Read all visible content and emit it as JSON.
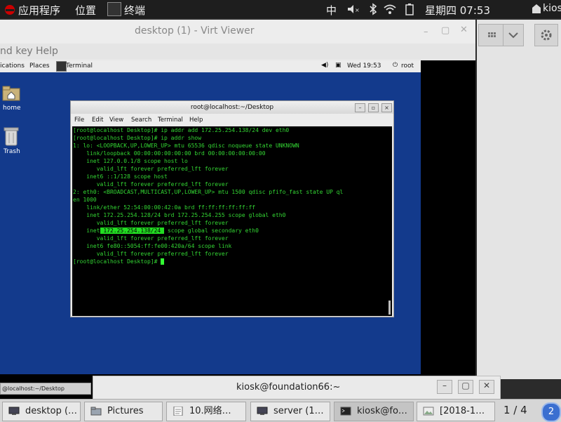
{
  "host_topbar": {
    "apps_label": "应用程序",
    "places_label": "位置",
    "terminal_label": "终端",
    "input_method": "中",
    "datetime": "星期四 07:53",
    "user": "kiosk"
  },
  "viewer": {
    "title": "desktop (1) - Virt Viewer",
    "menu_items": [
      "nd key",
      "Help"
    ]
  },
  "guest_topbar": {
    "applications": "ications",
    "places": "Places",
    "terminal": "Terminal",
    "datetime": "Wed 19:53",
    "user": "root"
  },
  "guest_desktop": {
    "icons": [
      {
        "label": "home",
        "icon": "home-folder-icon"
      },
      {
        "label": "Trash",
        "icon": "trash-icon"
      }
    ],
    "taskbar_item": "@localhost:~/Desktop",
    "workspace": "1 / 4"
  },
  "terminal": {
    "title": "root@localhost:~/Desktop",
    "menu": [
      "File",
      "Edit",
      "View",
      "Search",
      "Terminal",
      "Help"
    ],
    "lines": [
      "[root@localhost Desktop]# ip addr add 172.25.254.138/24 dev eth0",
      "[root@localhost Desktop]# ip addr show",
      "1: lo: <LOOPBACK,UP,LOWER_UP> mtu 65536 qdisc noqueue state UNKNOWN",
      "    link/loopback 00:00:00:00:00:00 brd 00:00:00:00:00:00",
      "    inet 127.0.0.1/8 scope host lo",
      "       valid_lft forever preferred_lft forever",
      "    inet6 ::1/128 scope host",
      "       valid_lft forever preferred_lft forever",
      "2: eth0: <BROADCAST,MULTICAST,UP,LOWER_UP> mtu 1500 qdisc pfifo_fast state UP ql",
      "en 1000",
      "    link/ether 52:54:00:00:42:0a brd ff:ff:ff:ff:ff:ff",
      "    inet 172.25.254.128/24 brd 172.25.254.255 scope global eth0",
      "       valid_lft forever preferred_lft forever",
      "    inet",
      "       valid_lft forever preferred_lft forever",
      "    inet6 fe80::5054:ff:fe00:420a/64 scope link",
      "       valid_lft forever preferred_lft forever",
      "[root@localhost Desktop]# "
    ],
    "highlight_ip": " 172.25.254.138/24 ",
    "highlight_rest": "scope global secondary eth0"
  },
  "kiosk_window": {
    "title": "kiosk@foundation66:~"
  },
  "taskbar": {
    "items": [
      {
        "label": "desktop (…",
        "icon": "monitor-icon"
      },
      {
        "label": "Pictures",
        "icon": "folder-icon"
      },
      {
        "label": "10.网络…",
        "icon": "text-editor-icon"
      },
      {
        "label": "server (1…",
        "icon": "monitor-icon"
      },
      {
        "label": "kiosk@fo…",
        "icon": "terminal-icon"
      },
      {
        "label": "[2018-1…",
        "icon": "image-icon"
      }
    ],
    "workspace": "1 / 4"
  }
}
